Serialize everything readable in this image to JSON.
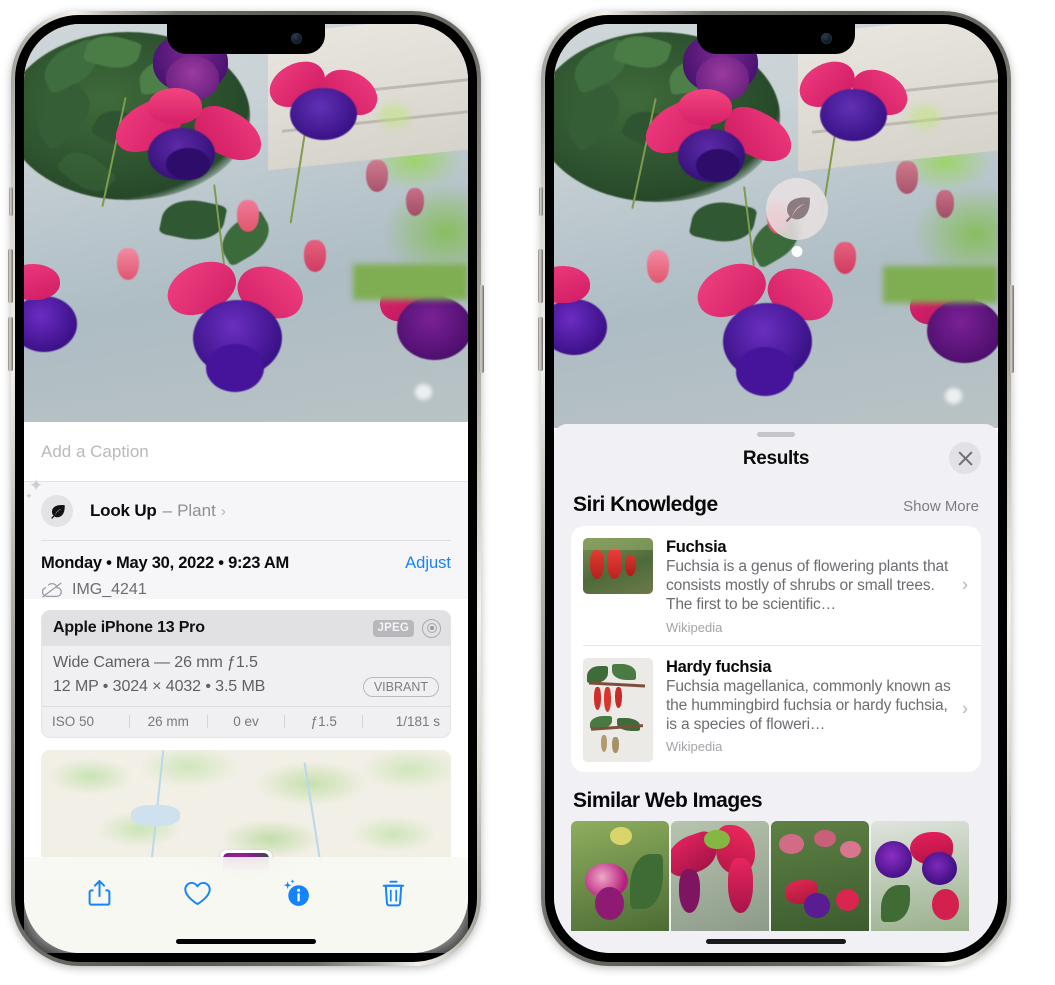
{
  "left_phone": {
    "caption_placeholder": "Add a Caption",
    "lookup": {
      "icon": "leaf-icon",
      "title": "Look Up",
      "separator": "–",
      "subject": "Plant",
      "chevron": "›"
    },
    "metadata": {
      "date": "Monday • May 30, 2022 • 9:23 AM",
      "adjust_label": "Adjust",
      "cloud_icon": "icloud-slash-icon",
      "filename": "IMG_4241"
    },
    "camera_card": {
      "device": "Apple iPhone 13 Pro",
      "format_badge": "JPEG",
      "raw_icon": "aperture-icon",
      "lens": "Wide Camera — 26 mm ƒ1.5",
      "file_info": "12 MP • 3024 × 4032 • 3.5 MB",
      "style_badge": "VIBRANT",
      "exif": [
        "ISO 50",
        "26 mm",
        "0 ev",
        "ƒ1.5",
        "1/181 s"
      ]
    },
    "toolbar": [
      {
        "name": "share-icon",
        "label": "Share"
      },
      {
        "name": "heart-icon",
        "label": "Favorite"
      },
      {
        "name": "info-sparkle-icon",
        "label": "Info"
      },
      {
        "name": "trash-icon",
        "label": "Delete"
      }
    ]
  },
  "right_phone": {
    "visual_lookup_badge": {
      "icon": "leaf-icon",
      "label": "Visual Look Up"
    },
    "sheet": {
      "grabber": "drag-handle",
      "title": "Results",
      "close_icon": "close-icon"
    },
    "siri_knowledge": {
      "section_title": "Siri Knowledge",
      "show_more": "Show More",
      "items": [
        {
          "title": "Fuchsia",
          "description": "Fuchsia is a genus of flowering plants that consists mostly of shrubs or small trees. The first to be scientific…",
          "source": "Wikipedia",
          "chevron": "›",
          "thumb": "fuchsia-wikipedia-thumb"
        },
        {
          "title": "Hardy fuchsia",
          "description": "Fuchsia magellanica, commonly known as the hummingbird fuchsia or hardy fuchsia, is a species of floweri…",
          "source": "Wikipedia",
          "chevron": "›",
          "thumb": "hardy-fuchsia-wikipedia-thumb"
        }
      ]
    },
    "similar_web_images": {
      "section_title": "Similar Web Images",
      "thumbnails": [
        "fuchsia-web-thumb-1",
        "fuchsia-web-thumb-2",
        "fuchsia-web-thumb-3",
        "fuchsia-web-thumb-4"
      ]
    }
  },
  "colors": {
    "accent_blue": "#1483ff",
    "sheet_bg": "#f1f1f5",
    "card_bg": "#ffffff",
    "secondary_text": "#8e8e93",
    "toolbar_bg": "#f7f8f2"
  }
}
